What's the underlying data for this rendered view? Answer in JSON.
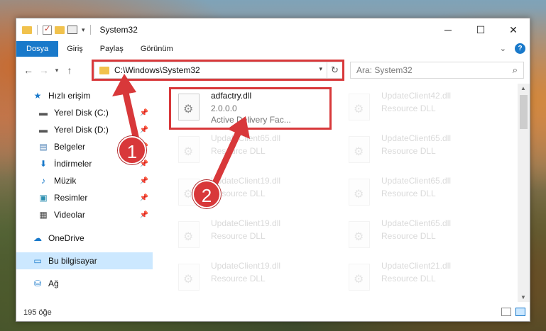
{
  "titlebar": {
    "title": "System32",
    "minimize_glyph": "─",
    "maximize_glyph": "☐",
    "close_glyph": "✕"
  },
  "ribbon": {
    "tabs": [
      "Dosya",
      "Giriş",
      "Paylaş",
      "Görünüm"
    ]
  },
  "address": {
    "path": "C:\\Windows\\System32",
    "search_placeholder": "Ara: System32"
  },
  "nav": {
    "items": [
      {
        "label": "Hızlı erişim",
        "icon": "star-icon"
      },
      {
        "label": "Yerel Disk (C:)",
        "icon": "drive-icon"
      },
      {
        "label": "Yerel Disk (D:)",
        "icon": "drive-icon"
      },
      {
        "label": "Belgeler",
        "icon": "documents-icon"
      },
      {
        "label": "İndirmeler",
        "icon": "download-icon"
      },
      {
        "label": "Müzik",
        "icon": "music-icon"
      },
      {
        "label": "Resimler",
        "icon": "pictures-icon"
      },
      {
        "label": "Videolar",
        "icon": "videos-icon"
      },
      {
        "label": "OneDrive",
        "icon": "cloud-icon"
      },
      {
        "label": "Bu bilgisayar",
        "icon": "computer-icon"
      },
      {
        "label": "Ağ",
        "icon": "network-icon"
      }
    ]
  },
  "files": {
    "selected": {
      "name": "adfactry.dll",
      "version": "2.0.0.0",
      "description": "Active Delivery Fac..."
    },
    "ghost": [
      {
        "name": "UpdateClient42.dll",
        "desc": "Resource DLL"
      },
      {
        "name": "UpdateClient65.dll",
        "desc": "Resource DLL"
      },
      {
        "name": "UpdateClient65.dll",
        "desc": "Resource DLL"
      },
      {
        "name": "UpdateClient19.dll",
        "desc": "Resource DLL"
      },
      {
        "name": "UpdateClient65.dll",
        "desc": "Resource DLL"
      },
      {
        "name": "UpdateClient19.dll",
        "desc": "Resource DLL"
      },
      {
        "name": "UpdateClient65.dll",
        "desc": "Resource DLL"
      },
      {
        "name": "UpdateClient19.dll",
        "desc": "Resource DLL"
      },
      {
        "name": "UpdateClient21.dll",
        "desc": "Resource DLL"
      }
    ]
  },
  "status": {
    "count": "195 öğe"
  },
  "callouts": {
    "one": "1",
    "two": "2"
  },
  "colors": {
    "accent": "#1979ca",
    "highlight": "#d8383a",
    "selection": "#cce8ff"
  }
}
